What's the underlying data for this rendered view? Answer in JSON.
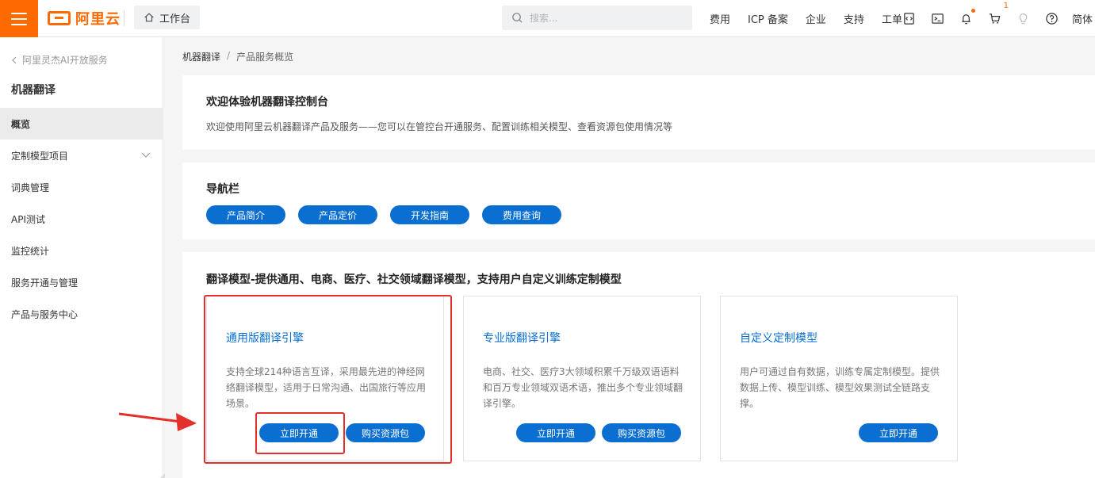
{
  "topbar": {
    "logo_text": "阿里云",
    "workbench_label": "工作台",
    "search_placeholder": "搜索...",
    "nav_links": [
      "费用",
      "ICP 备案",
      "企业",
      "支持",
      "工单"
    ],
    "cart_count": "1",
    "lang": "简体",
    "accent_color": "#ff6a00"
  },
  "sidebar": {
    "back_label": "阿里灵杰AI开放服务",
    "title": "机器翻译",
    "items": [
      {
        "label": "概览",
        "active": true
      },
      {
        "label": "定制模型项目",
        "expandable": true
      },
      {
        "label": "词典管理"
      },
      {
        "label": "API测试"
      },
      {
        "label": "监控统计"
      },
      {
        "label": "服务开通与管理"
      },
      {
        "label": "产品与服务中心"
      }
    ]
  },
  "breadcrumb": {
    "root": "机器翻译",
    "separator": "/",
    "current": "产品服务概览"
  },
  "welcome": {
    "title": "欢迎体验机器翻译控制台",
    "desc": "欢迎使用阿里云机器翻译产品及服务——您可以在管控台开通服务、配置训练相关模型、查看资源包使用情况等"
  },
  "navbar_panel": {
    "title": "导航栏",
    "buttons": [
      "产品简介",
      "产品定价",
      "开发指南",
      "费用查询"
    ]
  },
  "models": {
    "title": "翻译模型-提供通用、电商、医疗、社交领域翻译模型，支持用户自定义训练定制模型",
    "cards": [
      {
        "title": "通用版翻译引擎",
        "desc": "支持全球214种语言互译，采用最先进的神经网络翻译模型，适用于日常沟通、出国旅行等应用场景。",
        "activate_label": "立即开通",
        "buy_label": "购买资源包"
      },
      {
        "title": "专业版翻译引擎",
        "desc": "电商、社交、医疗3大领域积累千万级双语语料和百万专业领域双语术语，推出多个专业领域翻译引擎。",
        "activate_label": "立即开通",
        "buy_label": "购买资源包"
      },
      {
        "title": "自定义定制模型",
        "desc": "用户可通过自有数据，训练专属定制模型。提供数据上传、模型训练、模型效果测试全链路支撑。",
        "activate_label": "立即开通"
      }
    ]
  },
  "colors": {
    "primary": "#0a6fd1",
    "annotation": "#e4302b"
  }
}
